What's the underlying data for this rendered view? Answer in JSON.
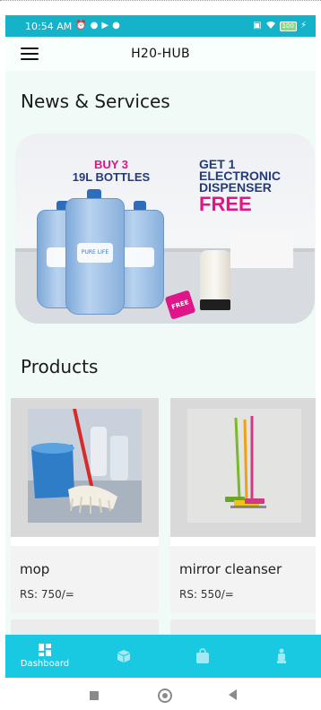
{
  "status_bar": {
    "time": "10:54 AM",
    "battery": "100",
    "icons": [
      "alarm-icon",
      "notification-icon",
      "play-icon",
      "cast-icon",
      "sim-icon",
      "wifi-icon",
      "battery-icon",
      "charging-icon"
    ]
  },
  "app_bar": {
    "title": "H20-HUB",
    "menu_icon": "hamburger-menu-icon"
  },
  "news": {
    "heading": "News & Services",
    "banner": {
      "left_line1": "BUY 3",
      "left_line2": "19L BOTTLES",
      "right_line1": "GET 1",
      "right_line2": "ELECTRONIC",
      "right_line3": "DISPENSER",
      "right_line4": "FREE",
      "tag": "FREE",
      "bottle_label": "PURE LIFE"
    }
  },
  "products": {
    "heading": "Products",
    "items": [
      {
        "name": "mop",
        "price": "RS: 750/="
      },
      {
        "name": "mirror cleanser",
        "price": "RS: 550/="
      }
    ]
  },
  "bottom_nav": {
    "items": [
      {
        "label": "Dashboard",
        "icon": "dashboard-icon",
        "active": true
      },
      {
        "label": "",
        "icon": "box-icon",
        "active": false
      },
      {
        "label": "",
        "icon": "shopping-bag-icon",
        "active": false
      },
      {
        "label": "",
        "icon": "delivery-icon",
        "active": false
      }
    ]
  },
  "colors": {
    "status_bar": "#14b3c9",
    "bottom_nav": "#19c9e2",
    "content_bg": "#f0fbf7",
    "banner_pink": "#e0158a",
    "banner_navy": "#233b7c"
  }
}
